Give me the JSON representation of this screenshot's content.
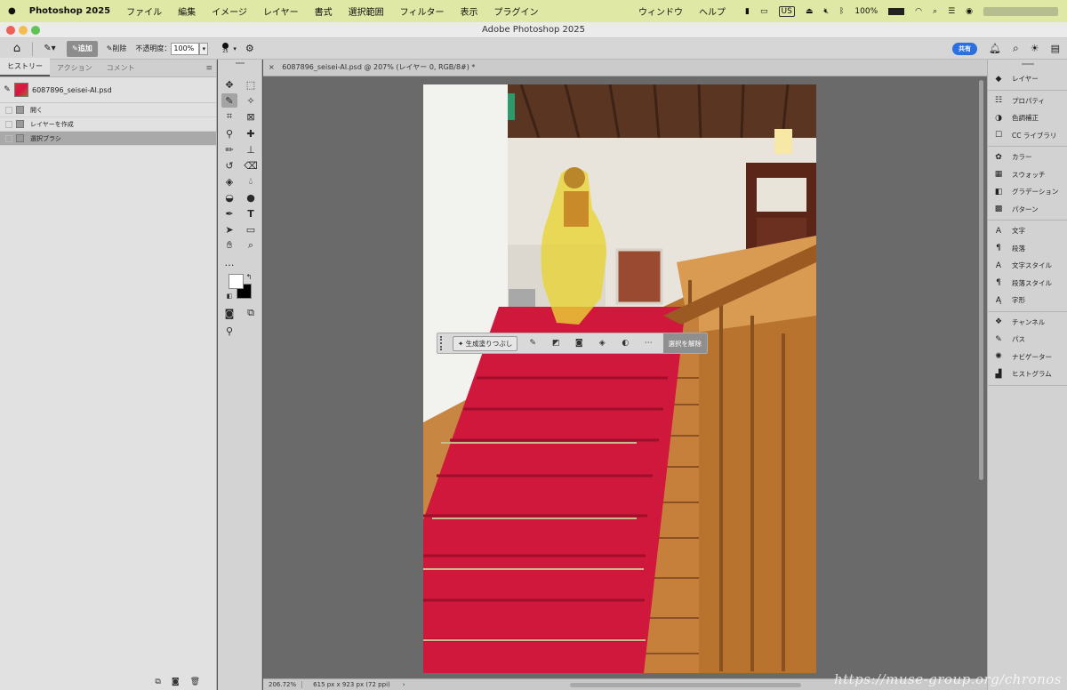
{
  "menubar": {
    "app": "Photoshop 2025",
    "items": [
      "ファイル",
      "編集",
      "イメージ",
      "レイヤー",
      "書式",
      "選択範囲",
      "フィルター",
      "表示",
      "プラグイン",
      "ウィンドウ",
      "ヘルプ"
    ],
    "lang": "US",
    "battery": "100%"
  },
  "window": {
    "title": "Adobe Photoshop 2025"
  },
  "options": {
    "add": "追加",
    "remove": "削除",
    "opacity_label": "不透明度：",
    "opacity_value": "100%",
    "brush_size": "25",
    "share": "共有"
  },
  "left_panel": {
    "tabs": [
      "ヒストリー",
      "アクション",
      "コメント"
    ],
    "snapshot": "6087896_seisei-AI.psd",
    "history": [
      "開く",
      "レイヤーを作成",
      "選択ブラシ"
    ]
  },
  "document": {
    "tab": "6087896_seisei-AI.psd @ 207% (レイヤー 0, RGB/8#) *",
    "zoom": "206.72%",
    "size": "615 px x 923 px (72 ppi)"
  },
  "context_bar": {
    "generative_fill": "生成塗りつぶし",
    "deselect": "選択を解除"
  },
  "right_panel": {
    "sections": [
      [
        {
          "icon": "layers-icon",
          "label": "レイヤー"
        }
      ],
      [
        {
          "icon": "properties-icon",
          "label": "プロパティ"
        },
        {
          "icon": "adjustments-icon",
          "label": "色調補正"
        },
        {
          "icon": "cc-libraries-icon",
          "label": "CC ライブラリ"
        }
      ],
      [
        {
          "icon": "color-icon",
          "label": "カラー"
        },
        {
          "icon": "swatches-icon",
          "label": "スウォッチ"
        },
        {
          "icon": "gradient-icon",
          "label": "グラデーション"
        },
        {
          "icon": "pattern-icon",
          "label": "パターン"
        }
      ],
      [
        {
          "icon": "character-icon",
          "label": "文字"
        },
        {
          "icon": "paragraph-icon",
          "label": "段落"
        },
        {
          "icon": "character-style-icon",
          "label": "文字スタイル"
        },
        {
          "icon": "paragraph-style-icon",
          "label": "段落スタイル"
        },
        {
          "icon": "glyphs-icon",
          "label": "字形"
        }
      ],
      [
        {
          "icon": "channels-icon",
          "label": "チャンネル"
        },
        {
          "icon": "paths-icon",
          "label": "パス"
        },
        {
          "icon": "navigator-icon",
          "label": "ナビゲーター"
        },
        {
          "icon": "histogram-icon",
          "label": "ヒストグラム"
        }
      ]
    ]
  },
  "watermark": "https://muse-group.org/chronos",
  "colors": {
    "menubar": "#dfe8a4",
    "selection": "#e9d335",
    "carpet": "#d0173c",
    "share": "#2b6fe0"
  }
}
